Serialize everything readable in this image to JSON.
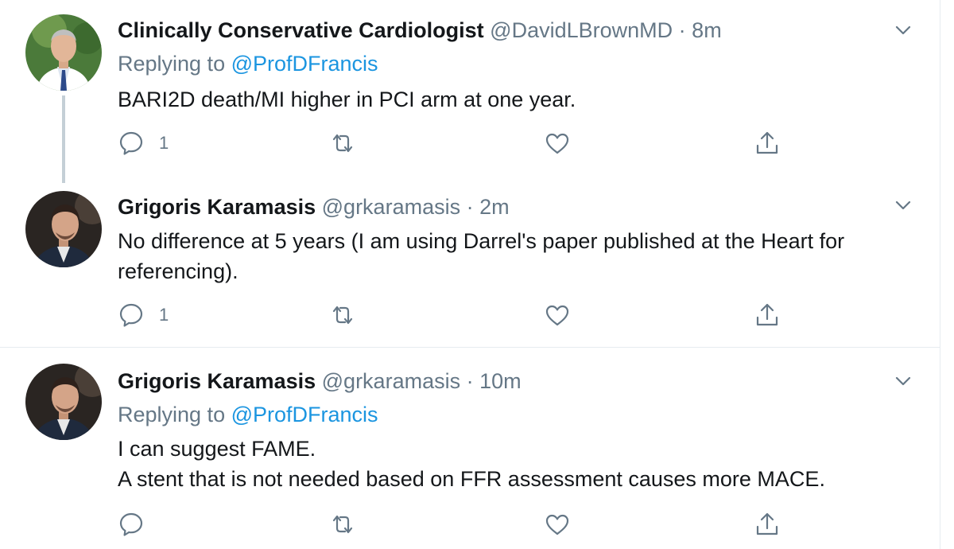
{
  "tweets": [
    {
      "name": "Clinically Conservative Cardiologist",
      "handle": "@DavidLBrownMD",
      "separator": "·",
      "time": "8m",
      "replying_prefix": "Replying to",
      "replying_to": "@ProfDFrancis",
      "lines": [
        "BARI2D death/MI higher in PCI arm at one year."
      ],
      "reply_count": "1"
    },
    {
      "name": "Grigoris Karamasis",
      "handle": "@grkaramasis",
      "separator": "·",
      "time": "2m",
      "lines": [
        "No difference at 5 years (I am using Darrel's paper published at the Heart for",
        "referencing)."
      ],
      "reply_count": "1"
    },
    {
      "name": "Grigoris Karamasis",
      "handle": "@grkaramasis",
      "separator": "·",
      "time": "10m",
      "replying_prefix": "Replying to",
      "replying_to": "@ProfDFrancis",
      "lines": [
        "I can suggest FAME.",
        "A stent that is not needed based on FFR assessment causes more MACE."
      ],
      "reply_count": ""
    }
  ],
  "colors": {
    "text": "#14171a",
    "muted": "#657786",
    "link": "#1b95e0",
    "thread_line": "#c4cfd6"
  },
  "icons": [
    "reply-icon",
    "retweet-icon",
    "like-icon",
    "share-icon",
    "chevron-down-icon",
    "avatar"
  ]
}
